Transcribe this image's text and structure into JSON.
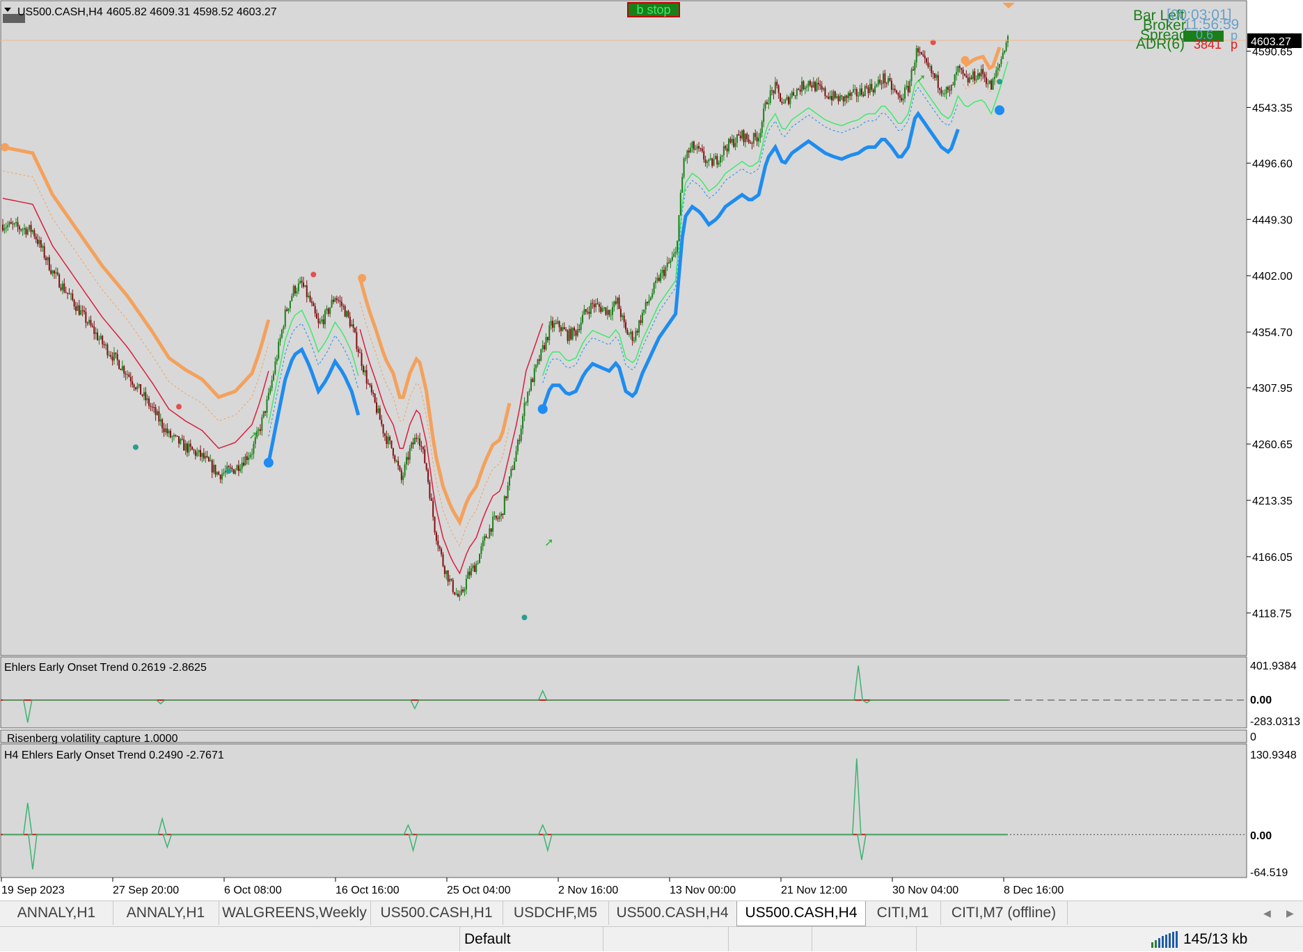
{
  "chart_data": {
    "type": "candlestick",
    "symbol": "US500.CASH,H4",
    "ohlc_text": "4605.82 4609.31 4598.52 4603.27",
    "status_label": "b stop",
    "current_price": "4603.27",
    "price_ticks": [
      {
        "label": "4590.65",
        "value": 4590.65
      },
      {
        "label": "4543.35",
        "value": 4543.35
      },
      {
        "label": "4496.60",
        "value": 4496.6
      },
      {
        "label": "4449.30",
        "value": 4449.3
      },
      {
        "label": "4402.00",
        "value": 4402.0
      },
      {
        "label": "4354.70",
        "value": 4354.7
      },
      {
        "label": "4307.95",
        "value": 4307.95
      },
      {
        "label": "4260.65",
        "value": 4260.65
      },
      {
        "label": "4213.35",
        "value": 4213.35
      },
      {
        "label": "4166.05",
        "value": 4166.05
      },
      {
        "label": "4118.75",
        "value": 4118.75
      }
    ],
    "ylim": [
      4083,
      4633
    ],
    "time_labels": [
      "19 Sep 2023",
      "27 Sep 20:00",
      "6 Oct 08:00",
      "16 Oct 16:00",
      "25 Oct 04:00",
      "2 Nov 16:00",
      "13 Nov 00:00",
      "21 Nov 12:00",
      "30 Nov 04:00",
      "8 Dec 16:00"
    ],
    "info_panel": {
      "bar_left_label": "Bar Left",
      "bar_left_value": "[00:03:01]",
      "broker_label": "Broker",
      "broker_value": "11:56:59",
      "spread_label": "Spread",
      "spread_value": "0.6",
      "spread_unit": "p",
      "adr_label": "ADR(6)",
      "adr_value": "3841",
      "adr_unit": "p"
    },
    "trend_path": [
      [
        0,
        4445
      ],
      [
        18,
        4440
      ],
      [
        30,
        4405
      ],
      [
        45,
        4375
      ],
      [
        60,
        4345
      ],
      [
        75,
        4320
      ],
      [
        90,
        4290
      ],
      [
        100,
        4268
      ],
      [
        110,
        4258
      ],
      [
        120,
        4250
      ],
      [
        130,
        4235
      ],
      [
        140,
        4240
      ],
      [
        150,
        4255
      ],
      [
        155,
        4275
      ],
      [
        160,
        4300
      ],
      [
        165,
        4335
      ],
      [
        170,
        4370
      ],
      [
        175,
        4390
      ],
      [
        180,
        4395
      ],
      [
        185,
        4380
      ],
      [
        190,
        4360
      ],
      [
        195,
        4370
      ],
      [
        200,
        4385
      ],
      [
        205,
        4375
      ],
      [
        210,
        4360
      ],
      [
        215,
        4335
      ],
      [
        220,
        4310
      ],
      [
        225,
        4290
      ],
      [
        230,
        4268
      ],
      [
        235,
        4255
      ],
      [
        240,
        4230
      ],
      [
        245,
        4255
      ],
      [
        250,
        4270
      ],
      [
        255,
        4240
      ],
      [
        260,
        4190
      ],
      [
        265,
        4160
      ],
      [
        270,
        4142
      ],
      [
        275,
        4130
      ],
      [
        280,
        4150
      ],
      [
        285,
        4160
      ],
      [
        290,
        4180
      ],
      [
        295,
        4195
      ],
      [
        300,
        4200
      ],
      [
        305,
        4230
      ],
      [
        310,
        4260
      ],
      [
        315,
        4300
      ],
      [
        320,
        4320
      ],
      [
        325,
        4340
      ],
      [
        330,
        4360
      ],
      [
        335,
        4360
      ],
      [
        340,
        4352
      ],
      [
        345,
        4355
      ],
      [
        350,
        4370
      ],
      [
        355,
        4378
      ],
      [
        360,
        4375
      ],
      [
        365,
        4372
      ],
      [
        370,
        4380
      ],
      [
        375,
        4355
      ],
      [
        380,
        4350
      ],
      [
        385,
        4370
      ],
      [
        390,
        4385
      ],
      [
        395,
        4400
      ],
      [
        400,
        4410
      ],
      [
        405,
        4420
      ],
      [
        410,
        4500
      ],
      [
        415,
        4510
      ],
      [
        420,
        4505
      ],
      [
        425,
        4495
      ],
      [
        430,
        4500
      ],
      [
        435,
        4510
      ],
      [
        440,
        4515
      ],
      [
        445,
        4520
      ],
      [
        450,
        4515
      ],
      [
        455,
        4520
      ],
      [
        460,
        4550
      ],
      [
        465,
        4560
      ],
      [
        470,
        4545
      ],
      [
        475,
        4555
      ],
      [
        480,
        4560
      ],
      [
        485,
        4565
      ],
      [
        490,
        4560
      ],
      [
        495,
        4555
      ],
      [
        500,
        4552
      ],
      [
        505,
        4550
      ],
      [
        510,
        4553
      ],
      [
        515,
        4555
      ],
      [
        520,
        4560
      ],
      [
        525,
        4560
      ],
      [
        530,
        4568
      ],
      [
        535,
        4560
      ],
      [
        540,
        4550
      ],
      [
        545,
        4560
      ],
      [
        550,
        4590
      ],
      [
        555,
        4580
      ],
      [
        560,
        4570
      ],
      [
        565,
        4560
      ],
      [
        570,
        4555
      ],
      [
        575,
        4575
      ],
      [
        580,
        4565
      ],
      [
        585,
        4570
      ],
      [
        590,
        4572
      ],
      [
        595,
        4560
      ],
      [
        600,
        4580
      ],
      [
        605,
        4604
      ]
    ],
    "indicator1": {
      "label": "Ehlers Early Onset Trend 0.2619 -2.8625",
      "max_label": "401.9384",
      "zero_label": "0.00",
      "min_label": "-283.0313",
      "ylim": [
        -283.0313,
        401.9384
      ],
      "spikes": [
        [
          15,
          -240
        ],
        [
          95,
          -40
        ],
        [
          248,
          -90
        ],
        [
          325,
          100
        ],
        [
          515,
          370
        ],
        [
          520,
          -30
        ]
      ]
    },
    "indicator_divider": {
      "label": "Risenberg volatility capture 1.0000",
      "value_label": "0"
    },
    "indicator2": {
      "label": "H4 Ehlers Early Onset Trend 0.2490 -2.7671",
      "max_label": "130.9348",
      "zero_label": "0.00",
      "min_label": "-64.519",
      "ylim": [
        -64.519,
        130.9348
      ],
      "spikes": [
        [
          15,
          50
        ],
        [
          18,
          -55
        ],
        [
          96,
          25
        ],
        [
          99,
          -20
        ],
        [
          244,
          15
        ],
        [
          247,
          -25
        ],
        [
          325,
          15
        ],
        [
          328,
          -25
        ],
        [
          514,
          120
        ],
        [
          517,
          -40
        ]
      ]
    }
  },
  "tabs": [
    {
      "label": "ANNALY,H1"
    },
    {
      "label": "ANNALY,H1"
    },
    {
      "label": "WALGREENS,Weekly"
    },
    {
      "label": "US500.CASH,H1"
    },
    {
      "label": "USDCHF,M5"
    },
    {
      "label": "US500.CASH,H4"
    },
    {
      "label": "US500.CASH,H4"
    },
    {
      "label": "CITI,M1"
    },
    {
      "label": "CITI,M7 (offline)"
    }
  ],
  "status": {
    "profile": "Default",
    "traffic": "145/13 kb"
  },
  "colors": {
    "background": "#d8d8d8",
    "bull": "#1a7f1a",
    "bear": "#7f1010",
    "orange_stop": "#f4a15c",
    "blue_stop": "#1e8cf0",
    "green_line": "#3dea6a",
    "red_line": "#d81e3c"
  }
}
